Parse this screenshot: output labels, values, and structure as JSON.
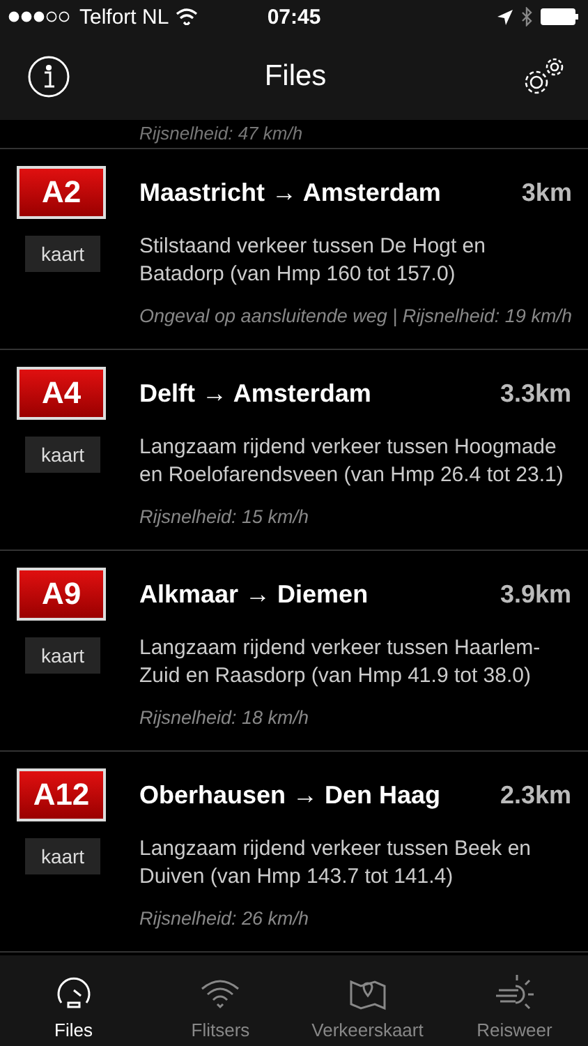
{
  "status_bar": {
    "carrier": "Telfort NL",
    "time": "07:45"
  },
  "nav": {
    "title": "Files"
  },
  "cut_row": {
    "footer": "Rijsnelheid: 47 km/h"
  },
  "jams": [
    {
      "road": "A2",
      "route": "Maastricht → Amsterdam",
      "distance": "3km",
      "map_button": "kaart",
      "description": "Stilstaand verkeer tussen De Hogt en Batadorp (van Hmp 160 tot 157.0)",
      "footer": "Ongeval op aansluitende weg | Rijsnelheid: 19 km/h"
    },
    {
      "road": "A4",
      "route": "Delft → Amsterdam",
      "distance": "3.3km",
      "map_button": "kaart",
      "description": "Langzaam rijdend verkeer tussen Hoogmade en Roelofarendsveen (van Hmp 26.4 tot 23.1)",
      "footer": "Rijsnelheid: 15 km/h"
    },
    {
      "road": "A9",
      "route": "Alkmaar → Diemen",
      "distance": "3.9km",
      "map_button": "kaart",
      "description": "Langzaam rijdend verkeer tussen Haarlem-Zuid en Raasdorp (van Hmp 41.9 tot 38.0)",
      "footer": "Rijsnelheid: 18 km/h"
    },
    {
      "road": "A12",
      "route": "Oberhausen → Den Haag",
      "distance": "2.3km",
      "map_button": "kaart",
      "description": "Langzaam rijdend verkeer tussen Beek en Duiven (van Hmp 143.7 tot 141.4)",
      "footer": "Rijsnelheid: 26 km/h"
    }
  ],
  "tabs": [
    {
      "kind": "speedometer",
      "label": "Files",
      "selected": true
    },
    {
      "kind": "signal",
      "label": "Flitsers",
      "selected": false
    },
    {
      "kind": "map",
      "label": "Verkeerskaart",
      "selected": false
    },
    {
      "kind": "weather",
      "label": "Reisweer",
      "selected": false
    }
  ]
}
